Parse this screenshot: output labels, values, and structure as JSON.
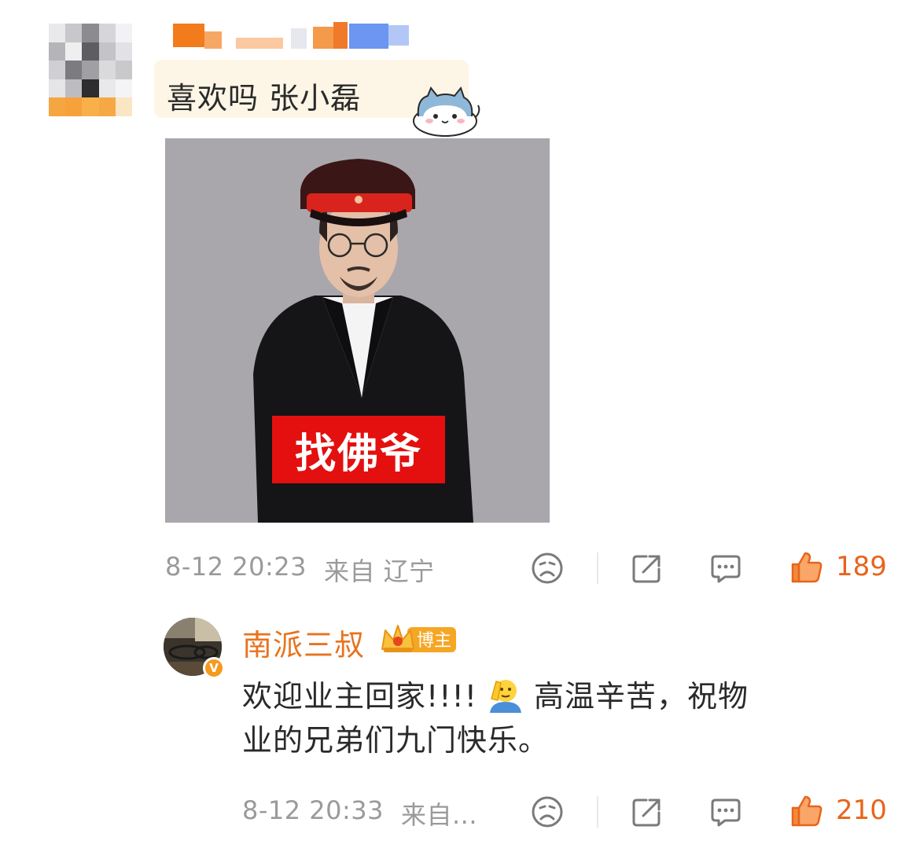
{
  "comment": {
    "text": "喜欢吗 张小磊",
    "photo_caption": "找佛爷",
    "timestamp": "8-12 20:23",
    "source": "来自 辽宁",
    "likes": "189"
  },
  "reply": {
    "author": "南派三叔",
    "badge_label": "博主",
    "verified_mark": "V",
    "text_line1a": "欢迎业主回家!!!!",
    "text_line1b": "高温辛苦，祝物",
    "text_line2": "业的兄弟们九门快乐。",
    "timestamp": "8-12 20:33",
    "source": "来自...",
    "likes": "210"
  },
  "icons": [
    "dislike-icon",
    "share-icon",
    "comment-icon",
    "like-icon",
    "salute-emoji-icon",
    "crown-icon",
    "cat-sticker-icon"
  ],
  "colors": {
    "accent_orange": "#e8641b",
    "name_orange": "#e8731e",
    "caption_red": "#e3100f",
    "meta_gray": "#9a9a9a"
  }
}
